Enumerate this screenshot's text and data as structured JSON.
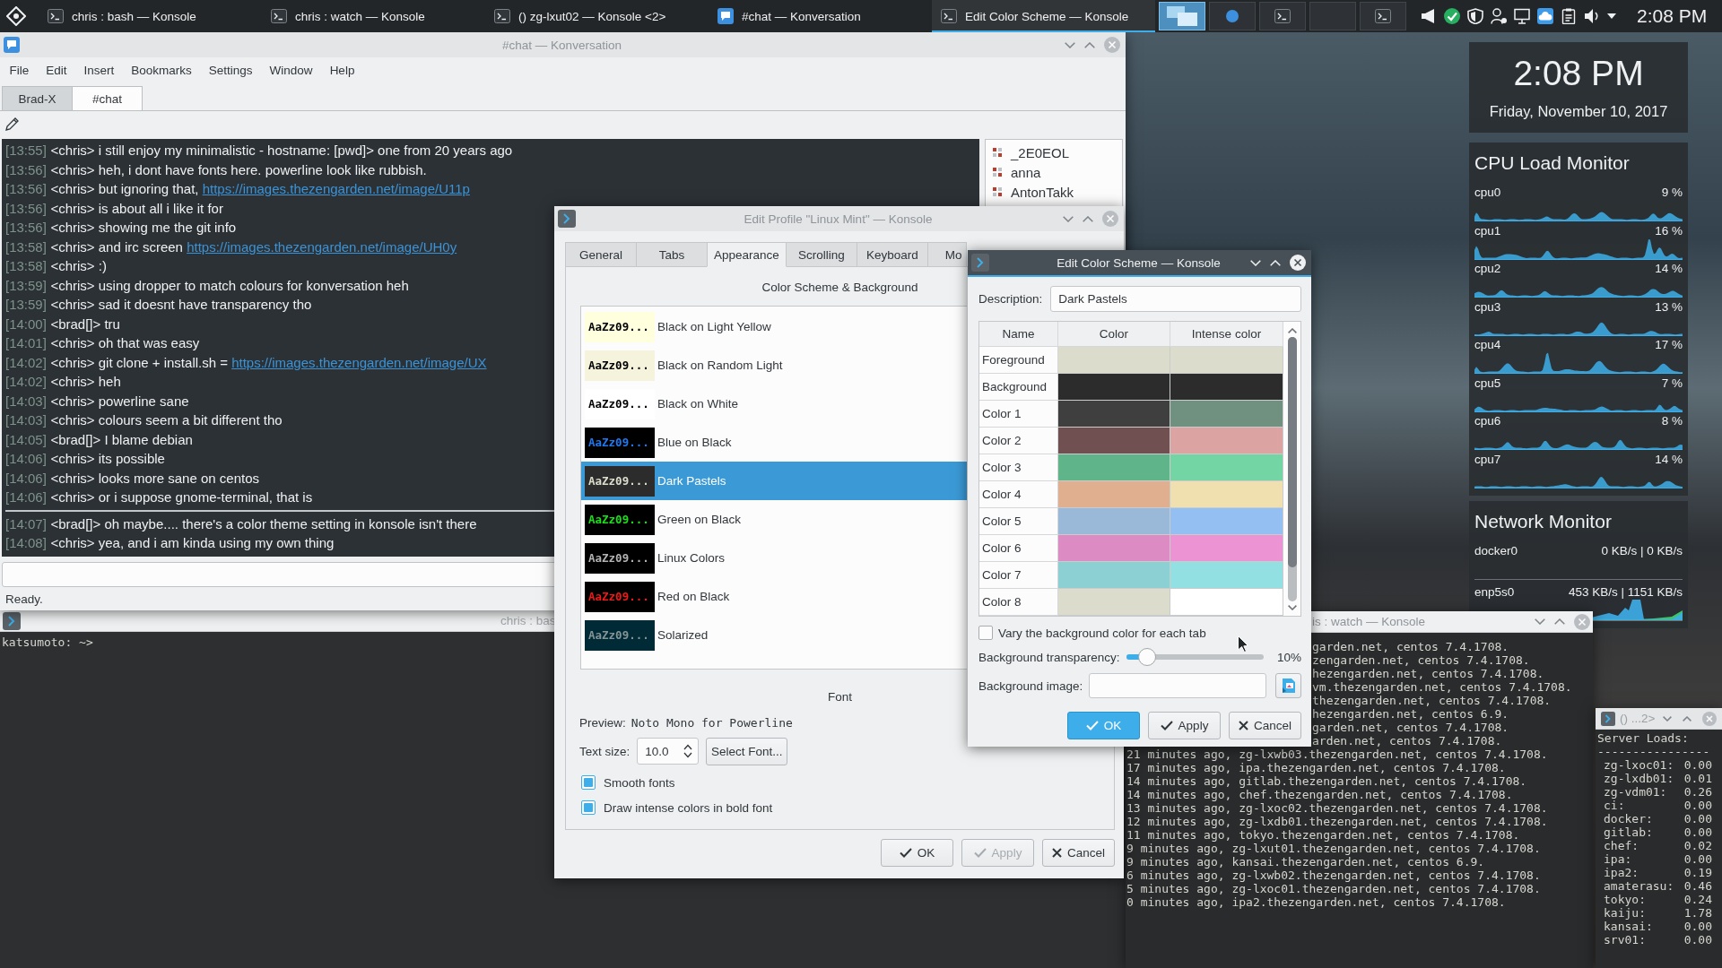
{
  "taskbar": {
    "tasks": [
      {
        "label": "chris : bash — Konsole",
        "kind": "terminal",
        "selected": false
      },
      {
        "label": "chris : watch — Konsole",
        "kind": "terminal",
        "selected": false
      },
      {
        "label": "() zg-lxut02 — Konsole <2>",
        "kind": "terminal",
        "selected": false
      },
      {
        "label": "#chat — Konversation",
        "kind": "chat",
        "selected": false
      },
      {
        "label": "Edit Color Scheme — Konsole",
        "kind": "terminal",
        "selected": true
      }
    ],
    "pager": [
      {
        "kind": "windows",
        "selected": true
      },
      {
        "kind": "circle",
        "selected": false
      },
      {
        "kind": "terminal",
        "selected": false
      },
      {
        "kind": "empty",
        "selected": false
      },
      {
        "kind": "terminal",
        "selected": false
      }
    ],
    "clock": "2:08 PM"
  },
  "konversation": {
    "title": "#chat — Konversation",
    "menu": [
      "File",
      "Edit",
      "Insert",
      "Bookmarks",
      "Settings",
      "Window",
      "Help"
    ],
    "tabs": [
      {
        "label": "Brad-X",
        "selected": false
      },
      {
        "label": "#chat",
        "selected": true
      }
    ],
    "messages": [
      {
        "kind": "message",
        "time": "[13:55]",
        "nick": "<chris>",
        "text": "i still enjoy my minimalistic - hostname: [pwd]> one from 20 years ago"
      },
      {
        "kind": "message",
        "time": "[13:56]",
        "nick": "<chris>",
        "text": "heh, i dont have fonts here. powerline look like rubbish."
      },
      {
        "kind": "message",
        "time": "[13:56]",
        "nick": "<chris>",
        "text": "but ignoring that,",
        "link": "https://images.thezengarden.net/image/U11p"
      },
      {
        "kind": "message",
        "time": "[13:56]",
        "nick": "<chris>",
        "text": "is about all i like it for"
      },
      {
        "kind": "message",
        "time": "[13:56]",
        "nick": "<chris>",
        "text": "showing me the git info"
      },
      {
        "kind": "message",
        "time": "[13:58]",
        "nick": "<chris>",
        "text": "and irc screen",
        "link": "https://images.thezengarden.net/image/UH0y"
      },
      {
        "kind": "message",
        "time": "[13:58]",
        "nick": "<chris>",
        "text": ":)"
      },
      {
        "kind": "message",
        "time": "[13:59]",
        "nick": "<chris>",
        "text": "using dropper to match colours for konversation heh"
      },
      {
        "kind": "message",
        "time": "[13:59]",
        "nick": "<chris>",
        "text": "sad it doesnt have transparency tho"
      },
      {
        "kind": "message",
        "time": "[14:00]",
        "nick": "<brad[]>",
        "text": "tru"
      },
      {
        "kind": "message",
        "time": "[14:01]",
        "nick": "<chris>",
        "text": "oh that was easy"
      },
      {
        "kind": "message",
        "time": "[14:02]",
        "nick": "<chris>",
        "text": "git clone + install.sh =",
        "link": "https://images.thezengarden.net/image/UX"
      },
      {
        "kind": "message",
        "time": "[14:02]",
        "nick": "<chris>",
        "text": "heh"
      },
      {
        "kind": "message",
        "time": "[14:03]",
        "nick": "<chris>",
        "text": "powerline sane"
      },
      {
        "kind": "message",
        "time": "[14:03]",
        "nick": "<chris>",
        "text": "colours seem a bit different tho"
      },
      {
        "kind": "message",
        "time": "[14:05]",
        "nick": "<brad[]>",
        "text": "I blame debian"
      },
      {
        "kind": "message",
        "time": "[14:06]",
        "nick": "<chris>",
        "text": "its possible"
      },
      {
        "kind": "message",
        "time": "[14:06]",
        "nick": "<chris>",
        "text": "looks more sane on centos"
      },
      {
        "kind": "message",
        "time": "[14:06]",
        "nick": "<chris>",
        "text": "or i suppose gnome-terminal, that is"
      },
      {
        "kind": "separator"
      },
      {
        "kind": "message",
        "time": "[14:07]",
        "nick": "<brad[]>",
        "text": "oh maybe.... there's a color theme setting in konsole isn't there"
      },
      {
        "kind": "message",
        "time": "[14:08]",
        "nick": "<chris>",
        "text": "yea, and i am kinda using my own thing"
      }
    ],
    "nicks": [
      "_2E0EOL",
      "anna",
      "AntonTakk"
    ],
    "status": "Ready."
  },
  "edit_profile": {
    "title": "Edit Profile \"Linux Mint\" — Konsole",
    "tabs": [
      {
        "label": "General",
        "selected": false
      },
      {
        "label": "Tabs",
        "selected": false
      },
      {
        "label": "Appearance",
        "selected": true
      },
      {
        "label": "Scrolling",
        "selected": false
      },
      {
        "label": "Keyboard",
        "selected": false
      },
      {
        "label": "Mo",
        "selected": false
      }
    ],
    "scheme_heading": "Color Scheme & Background",
    "schemes": [
      {
        "name": "Black on Light Yellow",
        "color": "#ffffdd",
        "preview": {
          "text": "AaZz09...",
          "color": "#000000"
        },
        "selected": false
      },
      {
        "name": "Black on Random Light",
        "color": "#f5f3dc",
        "preview": {
          "text": "AaZz09...",
          "color": "#000000"
        },
        "selected": false
      },
      {
        "name": "Black on White",
        "color": "#ffffff",
        "preview": {
          "text": "AaZz09...",
          "color": "#000000"
        },
        "selected": false
      },
      {
        "name": "Blue on Black",
        "color": "#000000",
        "preview": {
          "text": "AaZz09...",
          "color": "#1e78f0"
        },
        "selected": false
      },
      {
        "name": "Dark Pastels",
        "color": "#2c2c2c",
        "preview": {
          "text": "AaZz09...",
          "color": "#dcdccc"
        },
        "selected": true
      },
      {
        "name": "Green on Black",
        "color": "#000000",
        "preview": {
          "text": "AaZz09...",
          "color": "#18e018"
        },
        "selected": false
      },
      {
        "name": "Linux Colors",
        "color": "#000000",
        "preview": {
          "text": "AaZz09...",
          "color": "#b2b2b2"
        },
        "selected": false
      },
      {
        "name": "Red on Black",
        "color": "#000000",
        "preview": {
          "text": "AaZz09...",
          "color": "#f01818"
        },
        "selected": false
      },
      {
        "name": "Solarized",
        "color": "#002b36",
        "preview": {
          "text": "AaZz09...",
          "color": "#839496"
        },
        "selected": false
      }
    ],
    "font_heading": "Font",
    "preview_label": "Preview:",
    "preview_font": "Noto Mono for Powerline",
    "text_size_label": "Text size:",
    "text_size": "10.0",
    "select_font": "Select Font...",
    "options": [
      {
        "label": "Smooth fonts",
        "checked": true
      },
      {
        "label": "Draw intense colors in bold font",
        "checked": true
      }
    ],
    "buttons": [
      {
        "kind": "ok",
        "label": "OK",
        "default": false,
        "disabled": false
      },
      {
        "kind": "apply",
        "label": "Apply",
        "default": false,
        "disabled": true
      },
      {
        "kind": "cancel",
        "label": "Cancel",
        "default": false,
        "disabled": false
      }
    ]
  },
  "color_scheme": {
    "title": "Edit Color Scheme — Konsole",
    "description_label": "Description:",
    "description": "Dark Pastels",
    "columns": [
      "Name",
      "Color",
      "Intense color"
    ],
    "rows": [
      {
        "name": "Foreground",
        "swatches": [
          {
            "color": "#dcdccc"
          },
          {
            "color": "#dcdccc"
          }
        ]
      },
      {
        "name": "Background",
        "swatches": [
          {
            "color": "#2c2c2c"
          },
          {
            "color": "#2c2c2c"
          }
        ]
      },
      {
        "name": "Color 1",
        "swatches": [
          {
            "color": "#3f3f3f"
          },
          {
            "color": "#709080"
          }
        ]
      },
      {
        "name": "Color 2",
        "swatches": [
          {
            "color": "#705050"
          },
          {
            "color": "#dca3a3"
          }
        ]
      },
      {
        "name": "Color 3",
        "swatches": [
          {
            "color": "#60b48a"
          },
          {
            "color": "#72d5a3"
          }
        ]
      },
      {
        "name": "Color 4",
        "swatches": [
          {
            "color": "#dfaf8f"
          },
          {
            "color": "#f0dfaf"
          }
        ]
      },
      {
        "name": "Color 5",
        "swatches": [
          {
            "color": "#9ab8d7"
          },
          {
            "color": "#94bff3"
          }
        ]
      },
      {
        "name": "Color 6",
        "swatches": [
          {
            "color": "#dc8cc3"
          },
          {
            "color": "#ec93d3"
          }
        ]
      },
      {
        "name": "Color 7",
        "swatches": [
          {
            "color": "#8cd0d3"
          },
          {
            "color": "#93e0e3"
          }
        ]
      },
      {
        "name": "Color 8",
        "swatches": [
          {
            "color": "#dcdccc"
          },
          {
            "color": "#ffffff"
          }
        ]
      }
    ],
    "vary": {
      "label": "Vary the background color for each tab",
      "checked": false
    },
    "transparency": {
      "label": "Background transparency:",
      "level": 0.1,
      "reading": "10%"
    },
    "image_label": "Background image:",
    "buttons": [
      {
        "kind": "ok",
        "label": "OK",
        "default": true,
        "disabled": false
      },
      {
        "kind": "apply",
        "label": "Apply",
        "default": false,
        "disabled": false
      },
      {
        "kind": "cancel",
        "label": "Cancel",
        "default": false,
        "disabled": false
      }
    ]
  },
  "desktop_widgets": {
    "clock": {
      "time": "2:08 PM",
      "date": "Friday, November 10, 2017"
    },
    "cpu_monitor": {
      "title": "CPU Load Monitor",
      "cores": [
        {
          "name": "cpu0",
          "load": "9 %"
        },
        {
          "name": "cpu1",
          "load": "16 %"
        },
        {
          "name": "cpu2",
          "load": "14 %"
        },
        {
          "name": "cpu3",
          "load": "13 %"
        },
        {
          "name": "cpu4",
          "load": "17 %"
        },
        {
          "name": "cpu5",
          "load": "7 %"
        },
        {
          "name": "cpu6",
          "load": "8 %"
        },
        {
          "name": "cpu7",
          "load": "14 %"
        }
      ]
    },
    "network_monitor": {
      "title": "Network Monitor",
      "interfaces": [
        {
          "name": "docker0",
          "rate": "0 KB/s | 0 KB/s"
        },
        {
          "name": "enp5s0",
          "rate": "453 KB/s | 1151 KB/s"
        }
      ]
    }
  },
  "bash_konsole": {
    "title": "chris : bas",
    "prompt": "katsumoto: ~>"
  },
  "watch_konsole": {
    "title": "is : watch — Konsole",
    "clipped_lines": [
      "garden.net, centos 7.4.1708.",
      "zengarden.net, centos 7.4.1708.",
      "hezengarden.net, centos 7.4.1708.",
      "vm.thezengarden.net, centos 7.4.1708.",
      "thezengarden.net, centos 7.4.1708.",
      "hezengarden.net, centos 6.9.",
      "garden.net, centos 7.4.1708.",
      "arden.net, centos 7.4.1708."
    ],
    "lines": [
      "21 minutes ago, zg-lxwb03.thezengarden.net, centos 7.4.1708.",
      "17 minutes ago, ipa.thezengarden.net, centos 7.4.1708.",
      "14 minutes ago, gitlab.thezengarden.net, centos 7.4.1708.",
      "14 minutes ago, chef.thezengarden.net, centos 7.4.1708.",
      "13 minutes ago, zg-lxoc02.thezengarden.net, centos 7.4.1708.",
      "12 minutes ago, zg-lxdb01.thezengarden.net, centos 7.4.1708.",
      "11 minutes ago, tokyo.thezengarden.net, centos 7.4.1708.",
      "9 minutes ago, zg-lxut01.thezengarden.net, centos 7.4.1708.",
      "9 minutes ago, kansai.thezengarden.net, centos 6.9.",
      "6 minutes ago, zg-lxwb02.thezengarden.net, centos 7.4.1708.",
      "5 minutes ago, zg-lxoc01.thezengarden.net, centos 7.4.1708.",
      "0 minutes ago, ipa2.thezengarden.net, centos 7.4.1708."
    ]
  },
  "server_konsole": {
    "title": "() ...2>",
    "heading": "Server Loads:",
    "rule": "----------------",
    "servers": [
      {
        "host": "zg-lxoc01:",
        "load": "0.00"
      },
      {
        "host": "zg-lxdb01:",
        "load": "0.01"
      },
      {
        "host": "zg-vdm01:",
        "load": "0.26"
      },
      {
        "host": "ci:",
        "load": "0.00"
      },
      {
        "host": "docker:",
        "load": "0.00"
      },
      {
        "host": "gitlab:",
        "load": "0.00"
      },
      {
        "host": "chef:",
        "load": "0.02"
      },
      {
        "host": "ipa:",
        "load": "0.00"
      },
      {
        "host": "ipa2:",
        "load": "0.19"
      },
      {
        "host": "amaterasu:",
        "load": "0.46"
      },
      {
        "host": "tokyo:",
        "load": "0.24"
      },
      {
        "host": "kaiju:",
        "load": "1.78"
      },
      {
        "host": "kansai:",
        "load": "0.00"
      },
      {
        "host": "srv01:",
        "load": "0.00"
      }
    ]
  }
}
